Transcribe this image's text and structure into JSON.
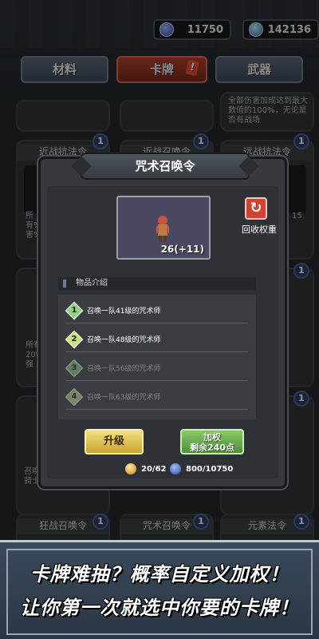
{
  "currency": {
    "gold": "11750",
    "gems": "142136"
  },
  "tabs": [
    {
      "label": "材料"
    },
    {
      "label": "卡牌"
    },
    {
      "label": "武器"
    }
  ],
  "background_cards": {
    "row1": [
      "近战抗法令",
      "近战召唤令",
      "远战抗法令"
    ],
    "row2": [
      "狂战召唤令",
      "咒术召唤令",
      "元素法令"
    ],
    "top_right_desc": "全部伤害加成达到最大数值的100%，无论是否有战场",
    "side_left_1": "所有%,3害%",
    "side_left_2": "所有20%强",
    "side_left_3": "召唤骑士",
    "side_right_1": "15",
    "badge": "1"
  },
  "modal": {
    "title": "咒术召唤令",
    "count": "26(+11)",
    "recycle_label": "回收权重",
    "section_title": "物品介绍",
    "items": [
      {
        "num": "1",
        "text": "召唤一队41级的咒术师",
        "color": "#8fd47a"
      },
      {
        "num": "2",
        "text": "召唤一队48级的咒术师",
        "color": "#c9e27a"
      },
      {
        "num": "3",
        "text": "召唤一队56级的咒术师",
        "color": "#8fd47a"
      },
      {
        "num": "4",
        "text": "召唤一队63级的咒术师",
        "color": "#c9e27a"
      }
    ],
    "upgrade_label": "升级",
    "weight_label_1": "加权",
    "weight_label_2": "剩余240点",
    "cost_cards": "20/62",
    "cost_gold": "800/10750"
  },
  "banner": {
    "line1": "卡牌难抽？概率自定义加权！",
    "line2": "让你第一次就选中你要的卡牌！"
  }
}
